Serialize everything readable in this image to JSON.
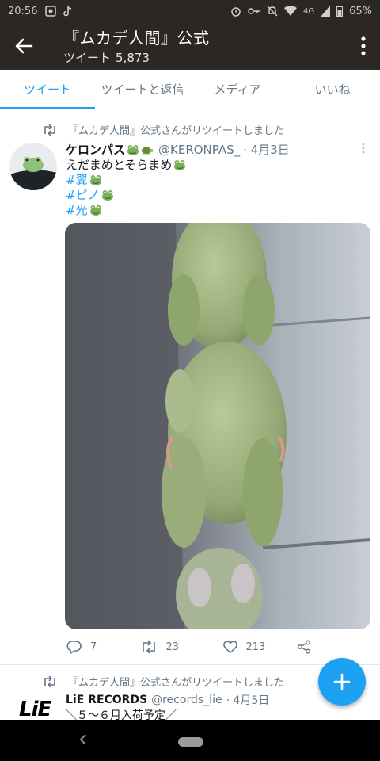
{
  "statusbar": {
    "time": "20:56",
    "network": "4G",
    "battery": "65%"
  },
  "header": {
    "title": "『ムカデ人間』公式",
    "subtitle_label": "ツイート",
    "tweet_count": "5,873"
  },
  "tabs": [
    {
      "label": "ツイート",
      "active": true
    },
    {
      "label": "ツイートと返信",
      "active": false
    },
    {
      "label": "メディア",
      "active": false
    },
    {
      "label": "いいね",
      "active": false
    }
  ],
  "tweet1": {
    "retweet_notice": "『ムカデ人間』公式さんがリツイートしました",
    "name": "ケロンパス",
    "handle": "@KERONPAS_",
    "date": "· 4月3日",
    "text_line1": "えだまめとそらまめ",
    "tag1": "#翼",
    "tag2": "#ピノ",
    "tag3": "#光",
    "replies": "7",
    "retweets": "23",
    "likes": "213"
  },
  "tweet2": {
    "retweet_notice": "『ムカデ人間』公式さんがリツイートしました",
    "name": "LiE RECORDS",
    "handle": "@records_lie",
    "date": "· 4月5日",
    "text_line1": "＼５～６月入荷予定／",
    "logo_text": "LiE"
  },
  "colors": {
    "accent": "#1da1f2",
    "header_bg": "#2b2725",
    "secondary_text": "#657786"
  }
}
